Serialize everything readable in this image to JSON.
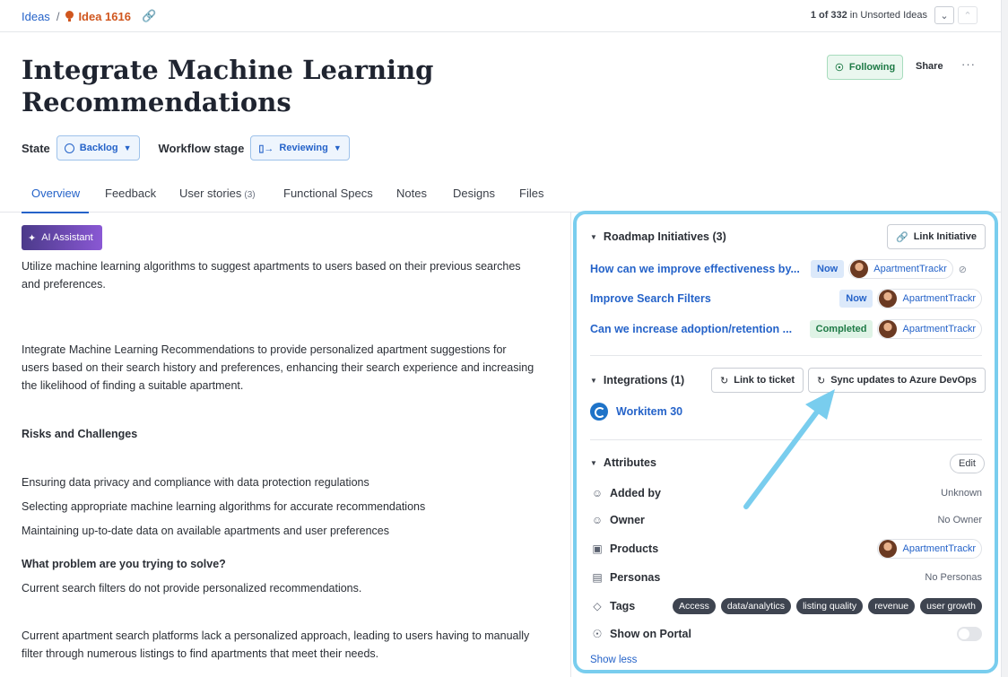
{
  "breadcrumb": {
    "ideas": "Ideas",
    "sep": "/",
    "idea": "Idea 1616"
  },
  "pager": {
    "position": "1 of 332",
    "context": "in Unsorted Ideas"
  },
  "title": "Integrate Machine Learning Recommendations",
  "actions": {
    "following": "Following",
    "share": "Share",
    "more": "···"
  },
  "state": {
    "label": "State",
    "value": "Backlog",
    "workflow_label": "Workflow stage",
    "workflow_value": "Reviewing"
  },
  "tabs": [
    {
      "label": "Overview"
    },
    {
      "label": "Feedback"
    },
    {
      "label": "User stories",
      "count": "(3)"
    },
    {
      "label": "Functional Specs"
    },
    {
      "label": "Notes"
    },
    {
      "label": "Designs"
    },
    {
      "label": "Files"
    }
  ],
  "ai_assistant": "AI Assistant",
  "content": {
    "p1_line1": "Utilize machine learning algorithms to suggest apartments to users based on their previous searches",
    "p1_line2": "and preferences.",
    "p2_line1": "Integrate Machine Learning Recommendations to provide personalized apartment suggestions for",
    "p2_line2": "users based on their search history and preferences, enhancing their search experience and increasing",
    "p2_line3": "the likelihood of finding a suitable apartment.",
    "risks_heading": "Risks and Challenges",
    "risk1": "Ensuring data privacy and compliance with data protection regulations",
    "risk2": "Selecting appropriate machine learning algorithms for accurate recommendations",
    "risk3": "Maintaining up-to-date data on available apartments and user preferences",
    "problem_heading": "What problem are you trying to solve?",
    "problem1": "Current search filters do not provide personalized recommendations.",
    "problem2_line1": "Current apartment search platforms lack a personalized approach, leading to users having to manually",
    "problem2_line2": "filter through numerous listings to find apartments that meet their needs."
  },
  "roadmap": {
    "heading": "Roadmap Initiatives (3)",
    "link_button": "Link Initiative",
    "items": [
      {
        "title": "How can we improve effectiveness by...",
        "status": "Now",
        "product": "ApartmentTrackr"
      },
      {
        "title": "Improve Search Filters",
        "status": "Now",
        "product": "ApartmentTrackr"
      },
      {
        "title": "Can we increase adoption/retention ...",
        "status": "Completed",
        "product": "ApartmentTrackr"
      }
    ]
  },
  "integrations": {
    "heading": "Integrations (1)",
    "link_ticket": "Link to ticket",
    "sync": "Sync updates to Azure DevOps",
    "workitem": "Workitem 30"
  },
  "attributes": {
    "heading": "Attributes",
    "edit": "Edit",
    "added_by": {
      "label": "Added by",
      "value": "Unknown"
    },
    "owner": {
      "label": "Owner",
      "value": "No Owner"
    },
    "products": {
      "label": "Products",
      "value": "ApartmentTrackr"
    },
    "personas": {
      "label": "Personas",
      "value": "No Personas"
    },
    "tags": {
      "label": "Tags",
      "items": [
        "Access",
        "data/analytics",
        "listing quality",
        "revenue",
        "user growth"
      ]
    },
    "show_on_portal": {
      "label": "Show on Portal",
      "enabled": false
    },
    "show_less": "Show less"
  },
  "colors": {
    "accent": "#2563c9",
    "idea": "#d0561e",
    "highlight": "#79cdee",
    "following": "#1e7a46"
  }
}
